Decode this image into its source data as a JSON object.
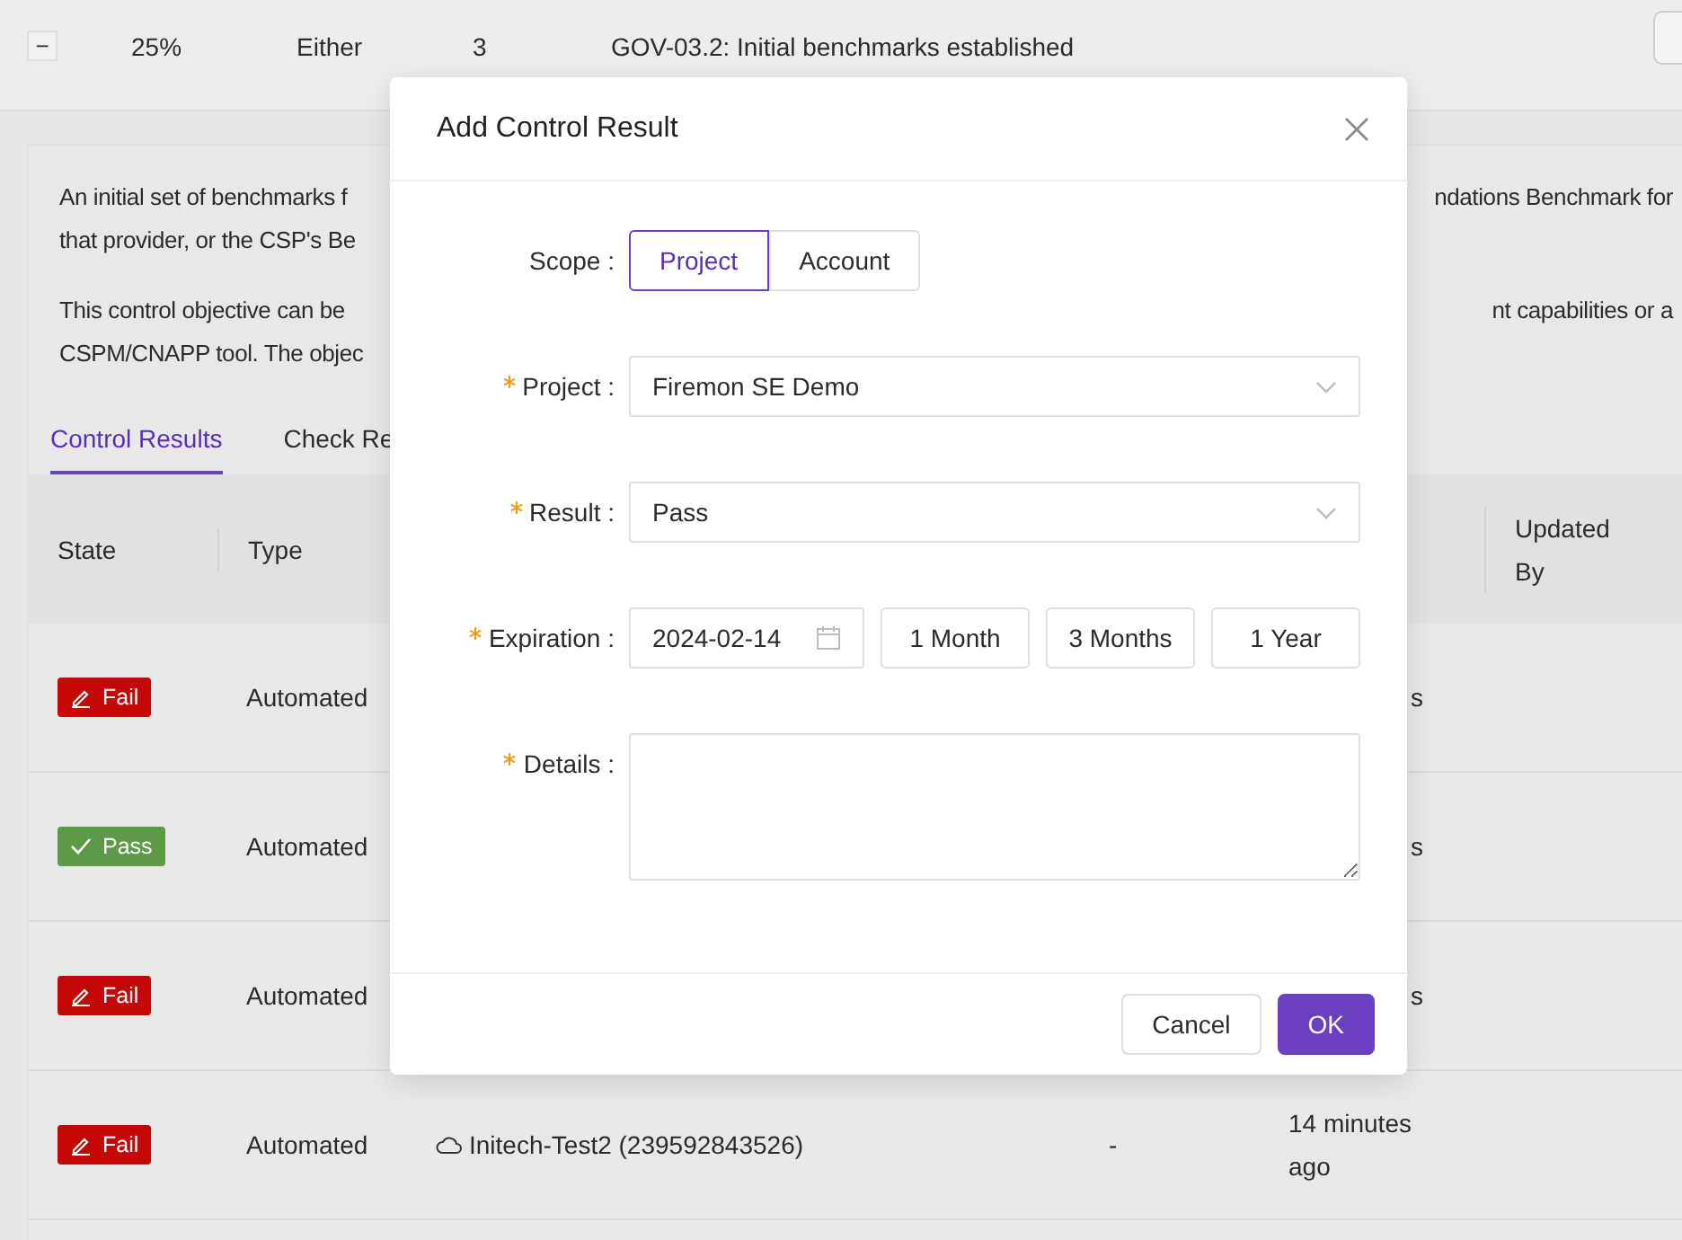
{
  "top_row": {
    "toggle": "−",
    "percent": "25%",
    "mode": "Either",
    "count": "3",
    "title": "GOV-03.2: Initial benchmarks established"
  },
  "description": [
    {
      "left": "An initial set of benchmarks f",
      "right": "ndations Benchmark for"
    },
    {
      "left": "that provider, or the CSP's Be"
    },
    {
      "left": "This control objective can be",
      "right": "nt capabilities or a"
    },
    {
      "left": "CSPM/CNAPP tool. The objec"
    }
  ],
  "tabs": [
    {
      "label": "Control Results",
      "selected": true
    },
    {
      "label": "Check Re",
      "selected": false
    }
  ],
  "table": {
    "columns": [
      {
        "label": "State"
      },
      {
        "label": "Type"
      },
      {
        "label": "Updated By"
      }
    ],
    "rows": [
      {
        "state": "Fail",
        "kind": "fail",
        "type": "Automated",
        "updated_fragment": "s"
      },
      {
        "state": "Pass",
        "kind": "pass",
        "type": "Automated",
        "updated_fragment": "s"
      },
      {
        "state": "Fail",
        "kind": "fail",
        "type": "Automated",
        "updated_fragment": "s"
      },
      {
        "state": "Fail",
        "kind": "fail",
        "type": "Automated",
        "account": "Initech-Test2 (239592843526)",
        "column_4": "-",
        "updated": "14 minutes ago"
      }
    ]
  },
  "dialog": {
    "title": "Add Control Result",
    "scope": {
      "label": "Scope :",
      "options": [
        {
          "label": "Project",
          "selected": true
        },
        {
          "label": "Account",
          "selected": false
        }
      ]
    },
    "fields": [
      {
        "label": "Project :",
        "required": true,
        "kind": "select",
        "value": "Firemon SE Demo"
      },
      {
        "label": "Result :",
        "required": true,
        "kind": "select",
        "value": "Pass"
      },
      {
        "label": "Expiration :",
        "required": true,
        "kind": "date",
        "value": "2024-02-14",
        "presets": [
          "1 Month",
          "3 Months",
          "1 Year"
        ]
      },
      {
        "label": "Details :",
        "required": true,
        "kind": "textarea"
      }
    ],
    "buttons": [
      {
        "label": "Cancel",
        "kind": "default"
      },
      {
        "label": "OK",
        "kind": "primary"
      }
    ]
  }
}
